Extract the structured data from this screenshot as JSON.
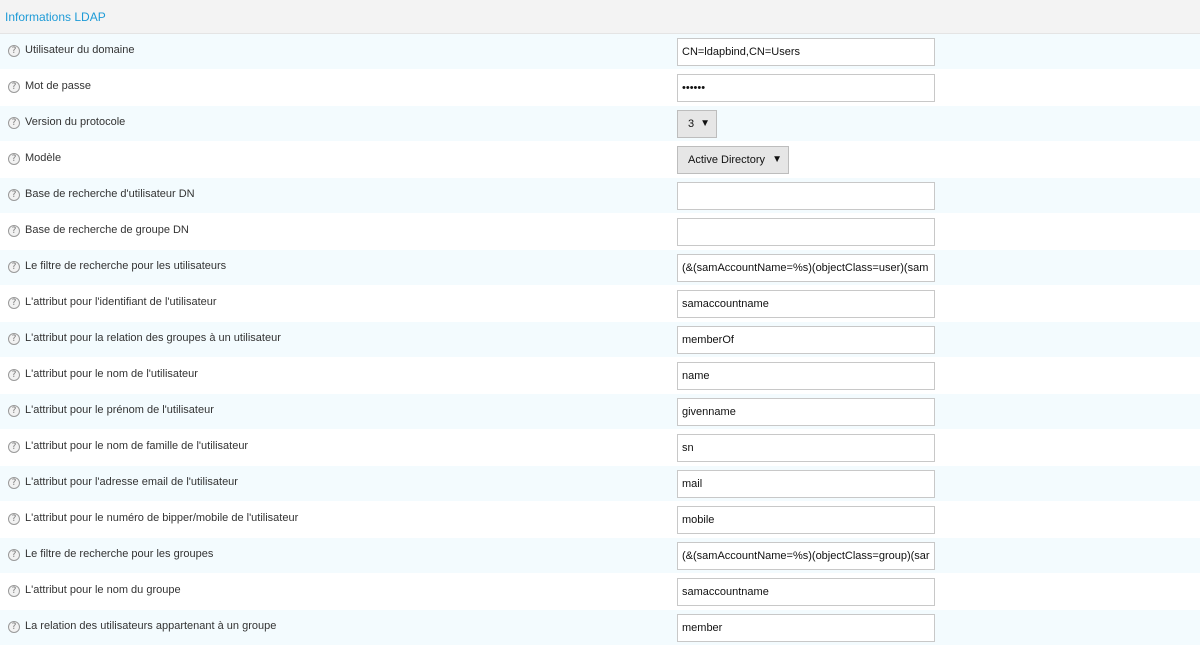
{
  "panel": {
    "title": "Informations LDAP"
  },
  "help_icon_glyph": "?",
  "fields": [
    {
      "label": "Utilisateur du domaine",
      "type": "text",
      "value": "CN=ldapbind,CN=Users"
    },
    {
      "label": "Mot de passe",
      "type": "password",
      "value": "••••••"
    },
    {
      "label": "Version du protocole",
      "type": "select",
      "value": "3"
    },
    {
      "label": "Modèle",
      "type": "select",
      "value": "Active Directory"
    },
    {
      "label": "Base de recherche d'utilisateur DN",
      "type": "text",
      "value": ""
    },
    {
      "label": "Base de recherche de groupe DN",
      "type": "text",
      "value": ""
    },
    {
      "label": "Le filtre de recherche pour les utilisateurs",
      "type": "text",
      "value": "(&(samAccountName=%s)(objectClass=user)(sam"
    },
    {
      "label": "L'attribut pour l'identifiant de l'utilisateur",
      "type": "text",
      "value": "samaccountname"
    },
    {
      "label": "L'attribut pour la relation des groupes à un utilisateur",
      "type": "text",
      "value": "memberOf"
    },
    {
      "label": "L'attribut pour le nom de l'utilisateur",
      "type": "text",
      "value": "name"
    },
    {
      "label": "L'attribut pour le prénom de l'utilisateur",
      "type": "text",
      "value": "givenname"
    },
    {
      "label": "L'attribut pour le nom de famille de l'utilisateur",
      "type": "text",
      "value": "sn"
    },
    {
      "label": "L'attribut pour l'adresse email de l'utilisateur",
      "type": "text",
      "value": "mail"
    },
    {
      "label": "L'attribut pour le numéro de bipper/mobile de l'utilisateur",
      "type": "text",
      "value": "mobile"
    },
    {
      "label": "Le filtre de recherche pour les groupes",
      "type": "text",
      "value": "(&(samAccountName=%s)(objectClass=group)(sar"
    },
    {
      "label": "L'attribut pour le nom du groupe",
      "type": "text",
      "value": "samaccountname"
    },
    {
      "label": "La relation des utilisateurs appartenant à un groupe",
      "type": "text",
      "value": "member"
    }
  ],
  "select_arrow_glyph": "▼"
}
